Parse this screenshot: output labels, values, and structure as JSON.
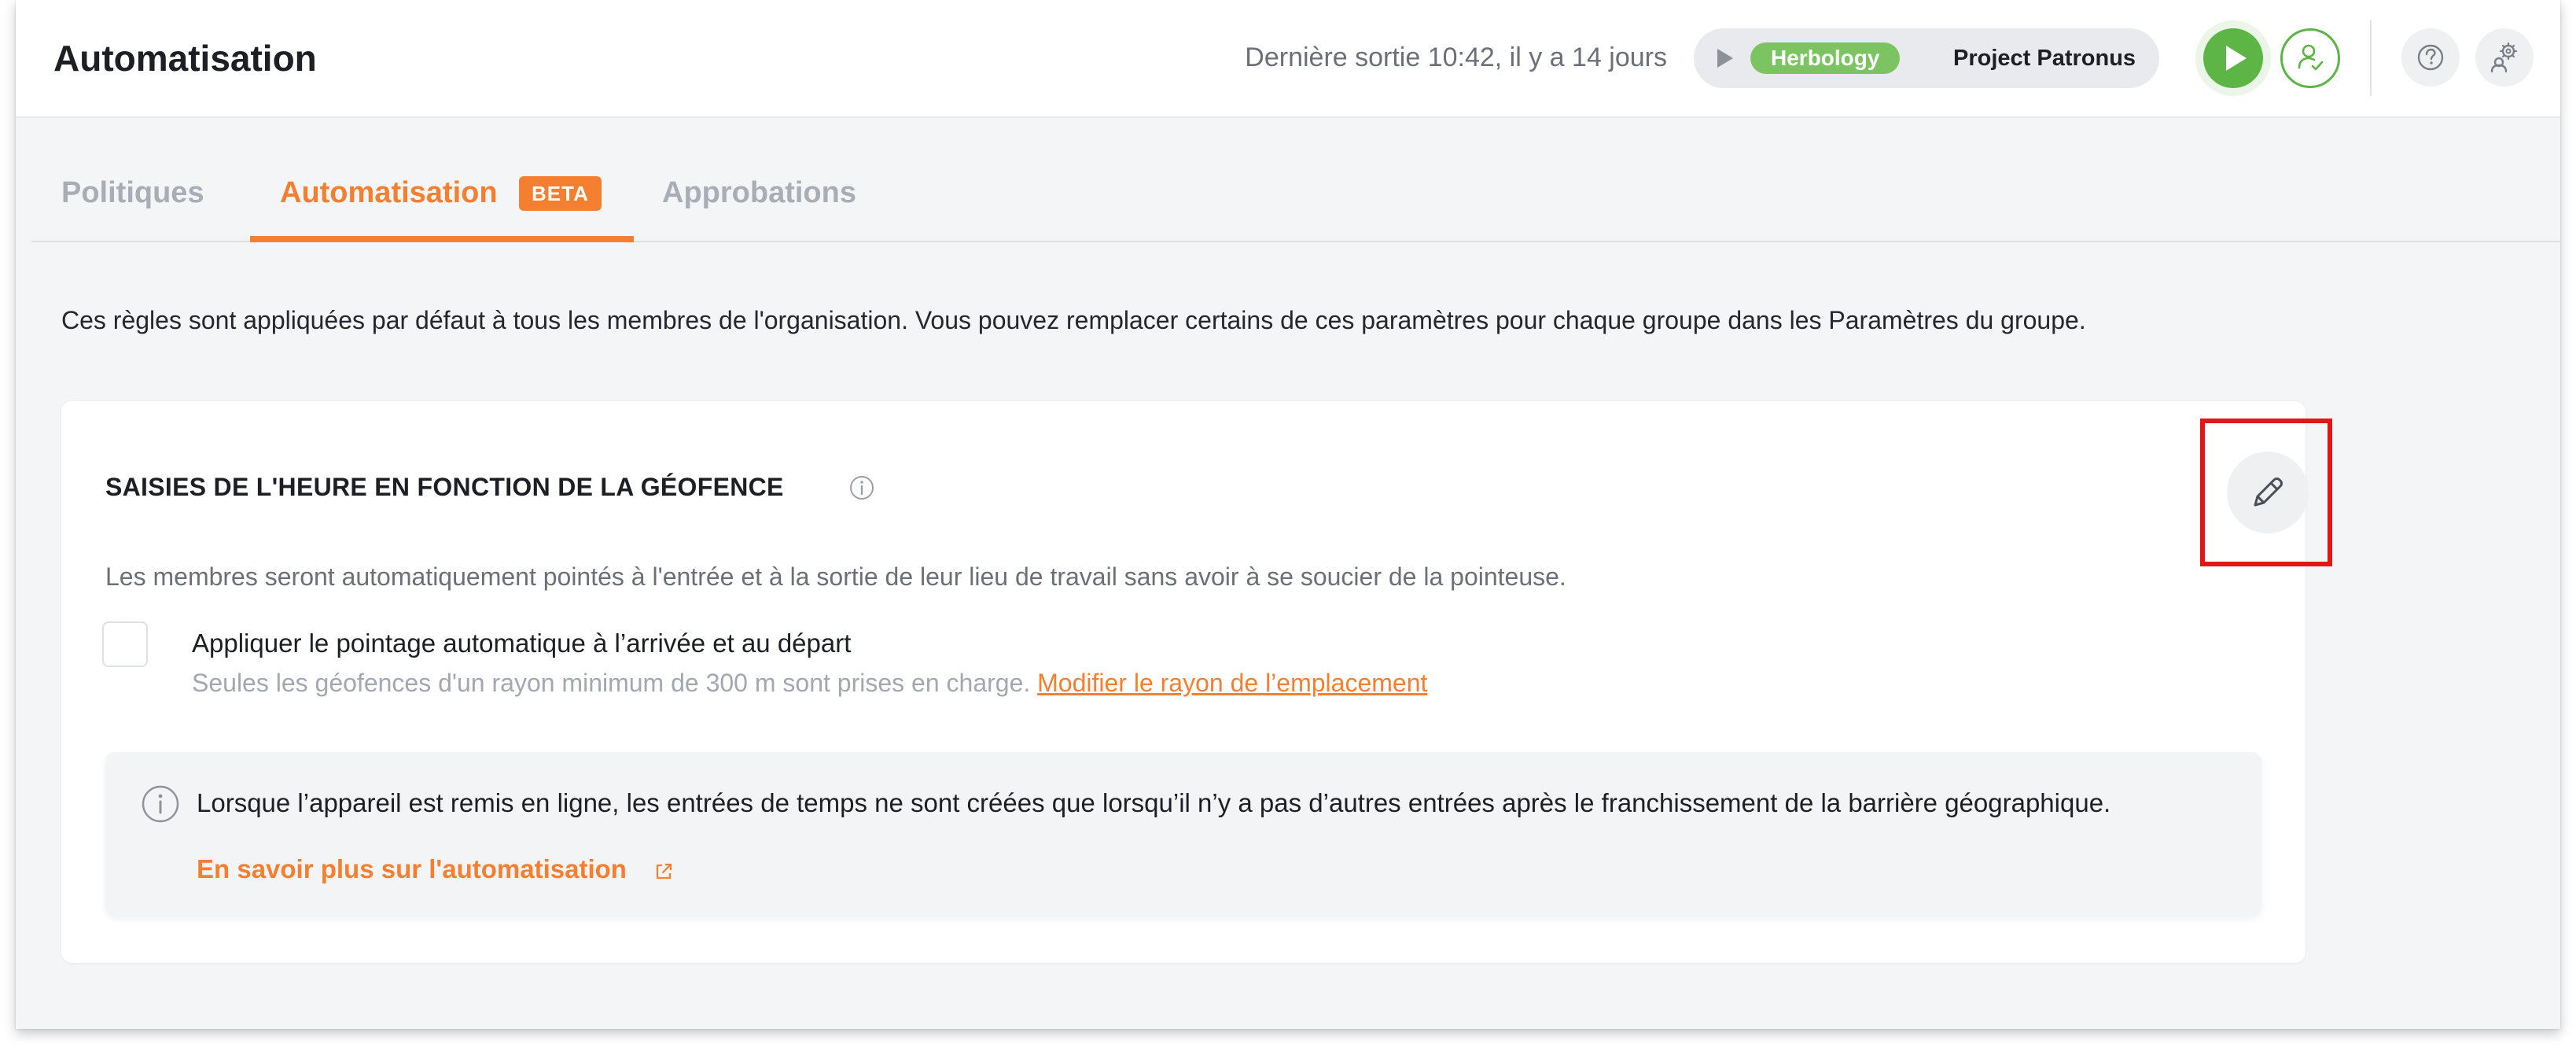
{
  "header": {
    "title": "Automatisation",
    "last_out": "Dernière sortie 10:42, il y a 14 jours",
    "timer": {
      "project_chip": "Herbology",
      "project_name": "Project Patronus"
    }
  },
  "tabs": [
    {
      "label": "Politiques",
      "active": false
    },
    {
      "label": "Automatisation",
      "active": true,
      "badge": "BETA"
    },
    {
      "label": "Approbations",
      "active": false
    }
  ],
  "intro": "Ces règles sont appliquées par défaut à tous les membres de l'organisation. Vous pouvez remplacer certains de ces paramètres pour chaque groupe dans les Paramètres du groupe.",
  "card": {
    "title": "SAISIES DE L'HEURE EN FONCTION DE LA GÉOFENCE",
    "description": "Les membres seront automatiquement pointés à l'entrée et à la sortie de leur lieu de travail sans avoir à se soucier de la pointeuse.",
    "checkbox": {
      "label": "Appliquer le pointage automatique à l’arrivée et au départ",
      "checked": false,
      "help": "Seules les géofences d'un rayon minimum de 300 m sont prises en charge. ",
      "link": "Modifier le rayon de l’emplacement"
    },
    "info": {
      "text": "Lorsque l’appareil est remis en ligne, les entrées de temps ne sont créées que lorsqu’il n’y a pas d’autres entrées après le franchissement de la barrière géographique.",
      "link": "En savoir plus sur l'automatisation"
    }
  },
  "colors": {
    "accent": "#f47f31",
    "green": "#5cb544",
    "project_chip": "#7cc462",
    "highlight": "#e11717"
  },
  "icons": {
    "timer_play": "play-icon",
    "start": "play-icon",
    "member": "user-check-icon",
    "help": "question-icon",
    "settings": "gear-user-icon",
    "info": "info-icon",
    "edit": "pencil-icon",
    "external": "external-link-icon"
  }
}
